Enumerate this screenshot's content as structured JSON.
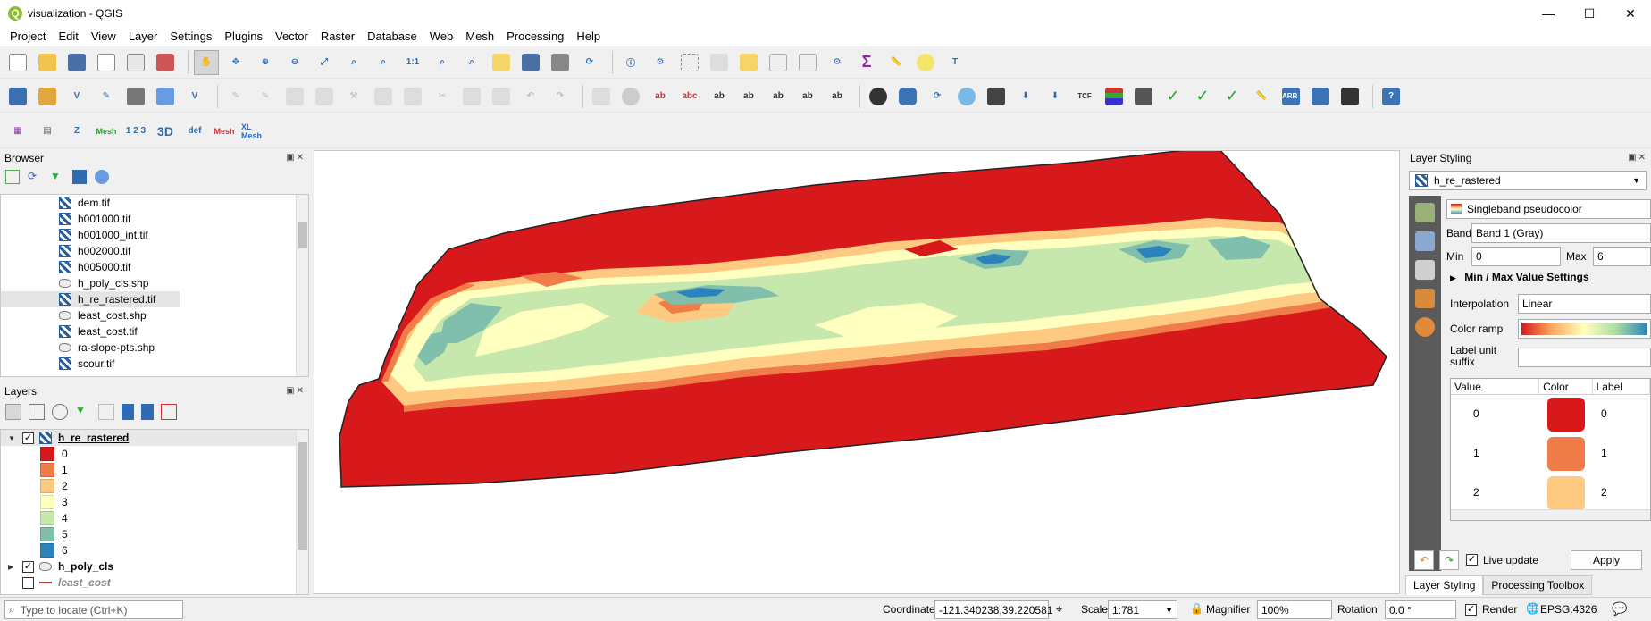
{
  "window": {
    "title": "visualization - QGIS",
    "icon": "qgis-logo-icon",
    "minimize": "—",
    "maximize": "☐",
    "close": "✕"
  },
  "menu": [
    "Project",
    "Edit",
    "View",
    "Layer",
    "Settings",
    "Plugins",
    "Vector",
    "Raster",
    "Database",
    "Web",
    "Mesh",
    "Processing",
    "Help"
  ],
  "toolbar3": {
    "mesh1": "Mesh",
    "num": "1 2 3",
    "zt": "Z",
    "threeD": "3D",
    "def": "def",
    "mesh2": "Mesh",
    "xlmesh": "XL Mesh"
  },
  "browser": {
    "title": "Browser",
    "items": [
      {
        "name": "dem.tif",
        "type": "raster"
      },
      {
        "name": "h001000.tif",
        "type": "raster"
      },
      {
        "name": "h001000_int.tif",
        "type": "raster"
      },
      {
        "name": "h002000.tif",
        "type": "raster"
      },
      {
        "name": "h005000.tif",
        "type": "raster"
      },
      {
        "name": "h_poly_cls.shp",
        "type": "vector"
      },
      {
        "name": "h_re_rastered.tif",
        "type": "raster"
      },
      {
        "name": "least_cost.shp",
        "type": "vector"
      },
      {
        "name": "least_cost.tif",
        "type": "raster"
      },
      {
        "name": "ra-slope-pts.shp",
        "type": "vector"
      },
      {
        "name": "scour.tif",
        "type": "raster"
      }
    ]
  },
  "layers": {
    "title": "Layers",
    "main_layer": "h_re_rastered",
    "legend": [
      {
        "label": "0",
        "color": "#d7191c"
      },
      {
        "label": "1",
        "color": "#f07c4a"
      },
      {
        "label": "2",
        "color": "#fec980"
      },
      {
        "label": "3",
        "color": "#ffffbf"
      },
      {
        "label": "4",
        "color": "#c7e8ad"
      },
      {
        "label": "5",
        "color": "#80bfab"
      },
      {
        "label": "6",
        "color": "#2b83ba"
      }
    ],
    "layer2": "h_poly_cls",
    "layer3": "least_cost"
  },
  "styling": {
    "title": "Layer Styling",
    "layer": "h_re_rastered",
    "renderer": "Singleband pseudocolor",
    "band_label": "Band",
    "band": "Band 1 (Gray)",
    "min_label": "Min",
    "min": "0",
    "max_label": "Max",
    "max": "6",
    "minmax_section": "Min / Max Value Settings",
    "interp_label": "Interpolation",
    "interp": "Linear",
    "ramp_label": "Color ramp",
    "suffix_label_1": "Label unit",
    "suffix_label_2": "suffix",
    "col_value": "Value",
    "col_color": "Color",
    "col_label": "Label",
    "rows": [
      {
        "value": "0",
        "color": "#d7191c",
        "label": "0"
      },
      {
        "value": "1",
        "color": "#f07c4a",
        "label": "1"
      },
      {
        "value": "2",
        "color": "#fec980",
        "label": "2"
      }
    ],
    "live_update": "Live update",
    "apply": "Apply",
    "tab1": "Layer Styling",
    "tab2": "Processing Toolbox"
  },
  "status": {
    "locate_placeholder": "Type to locate (Ctrl+K)",
    "coordinate_label": "Coordinate",
    "coordinate": "-121.340238,39.220581",
    "scale_label": "Scale",
    "scale": "1:781",
    "magnifier_label": "Magnifier",
    "magnifier": "100%",
    "rotation_label": "Rotation",
    "rotation": "0.0 °",
    "render": "Render",
    "crs": "EPSG:4326"
  }
}
